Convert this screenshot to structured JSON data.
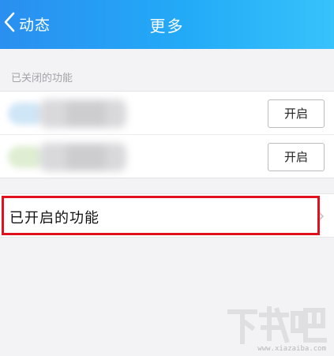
{
  "header": {
    "back_label": "动态",
    "title": "更多"
  },
  "section": {
    "disabled_label": "已关闭的功能"
  },
  "disabled_items": [
    {
      "button_label": "开启"
    },
    {
      "button_label": "开启"
    }
  ],
  "enabled_row": {
    "label": "已开启的功能"
  },
  "watermark": {
    "brand": "下载吧",
    "url": "www.xiazaiba.com"
  },
  "colors": {
    "header_start": "#2a8ff0",
    "header_end": "#38c2fb",
    "highlight": "#e0101e",
    "background": "#f3f3f5"
  }
}
